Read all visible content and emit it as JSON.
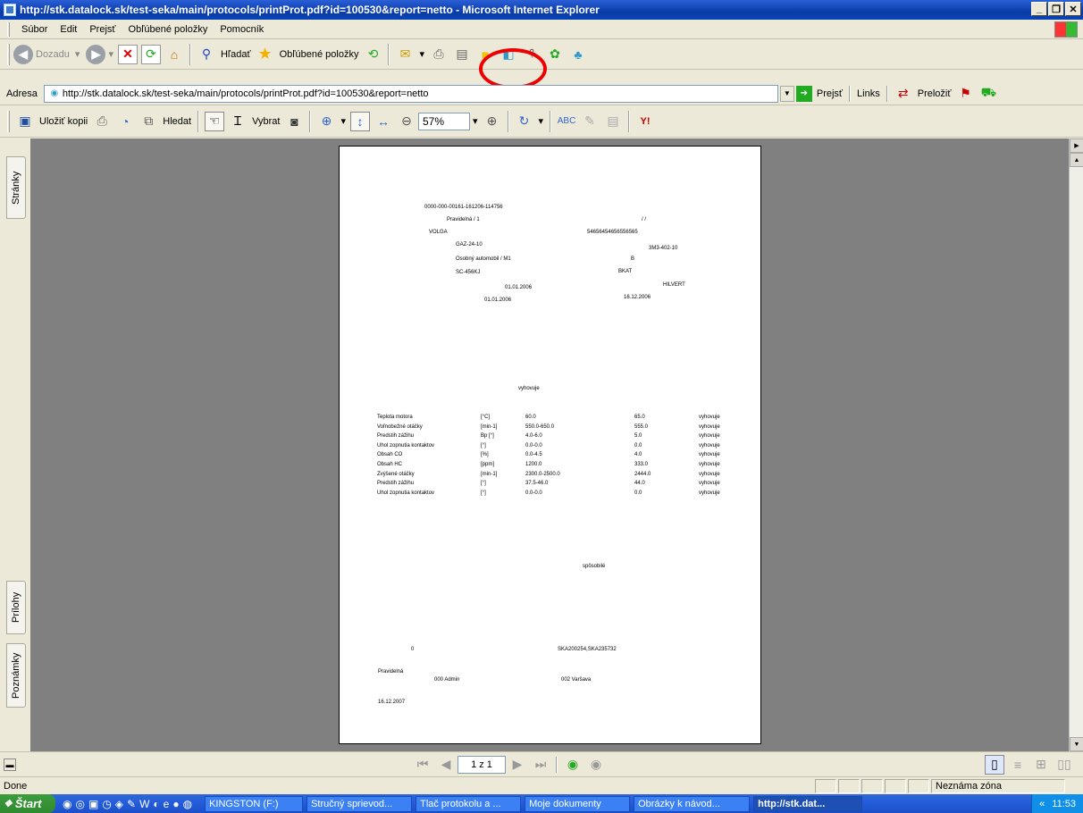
{
  "window": {
    "title": "http://stk.datalock.sk/test-seka/main/protocols/printProt.pdf?id=100530&report=netto - Microsoft Internet Explorer",
    "controls": [
      "_",
      "❐",
      "✕"
    ]
  },
  "menu": [
    "Súbor",
    "Edit",
    "Prejsť",
    "Obľúbené položky",
    "Pomocník"
  ],
  "toolbar1": {
    "back_label": "Dozadu",
    "search_label": "Hľadať",
    "favorites_label": "Obľúbené položky"
  },
  "address": {
    "label": "Adresa",
    "url": "http://stk.datalock.sk/test-seka/main/protocols/printProt.pdf?id=100530&report=netto",
    "go_label": "Prejsť",
    "links_label": "Links",
    "translate_label": "Preložiť"
  },
  "toolbar2": {
    "save_copy_label": "Uložiť kopii",
    "find_label": "Hledat",
    "select_label": "Vybrat",
    "zoom_value": "57%"
  },
  "side_tabs": {
    "pages": "Stránky",
    "attachments": "Prílohy",
    "notes": "Poznámky"
  },
  "document": {
    "header": {
      "protocol_no": "0000-000-00161-161206-114756",
      "type": "Pravidelná / 1",
      "slashes": "/ /",
      "make": "VOLGA",
      "vin": "54656454656556565",
      "model": "GAZ-24-10",
      "engine": "3M3-402-10",
      "category": "Osobný automobil / M1",
      "class": "B",
      "plate": "SC-456KJ",
      "owner": "BKAT",
      "date1": "01.01.2006",
      "holder": "HILVERT",
      "date2": "01.01.2006",
      "date3": "16.12.2006"
    },
    "result_top": "vyhovuje",
    "measurements": [
      {
        "name": "Teplota motora",
        "unit": "[°C]",
        "range": "60.0",
        "value": "65.0",
        "result": "vyhovuje"
      },
      {
        "name": "Voľnobežné otáčky",
        "unit": "[min-1]",
        "range": "550.0-650.0",
        "value": "555.0",
        "result": "vyhovuje"
      },
      {
        "name": "Predstih zážihu",
        "unit": "Bp [°]",
        "range": "4.0-6.0",
        "value": "5.0",
        "result": "vyhovuje"
      },
      {
        "name": "Uhol zopnutia kontaktov",
        "unit": "[°]",
        "range": "0.0-0.0",
        "value": "0.0",
        "result": "vyhovuje"
      },
      {
        "name": "Obsah CO",
        "unit": "[%]",
        "range": "0.0-4.5",
        "value": "4.0",
        "result": "vyhovuje"
      },
      {
        "name": "Obsah HC",
        "unit": "[ppm]",
        "range": "1200.0",
        "value": "333.0",
        "result": "vyhovuje"
      },
      {
        "name": "Zvýšené otáčky",
        "unit": "[min-1]",
        "range": "2300.0-2500.0",
        "value": "2444.0",
        "result": "vyhovuje"
      },
      {
        "name": "Predstih zážihu",
        "unit": "[°]",
        "range": "37.5-46.0",
        "value": "44.0",
        "result": "vyhovuje"
      },
      {
        "name": "Uhol zopnutia kontaktov",
        "unit": "[°]",
        "range": "0.0-0.0",
        "value": "0.0",
        "result": "vyhovuje"
      }
    ],
    "verdict": "spôsobilé",
    "footer": {
      "zero": "0",
      "codes": "SKA200254,SKA235732",
      "type": "Pravidelná",
      "admin": "000  Admin",
      "station": "002 Varšava",
      "date": "16.12.2007"
    }
  },
  "nav": {
    "page_indicator": "1 z 1"
  },
  "status": {
    "left": "Done",
    "zone": "Neznáma zóna"
  },
  "taskbar": {
    "start": "Štart",
    "tasks": [
      "KINGSTON (F:)",
      "Stručný sprievod...",
      "Tlač protokolu a ...",
      "Moje dokumenty",
      "Obrázky k návod...",
      "http://stk.dat..."
    ],
    "clock": "11:53",
    "chevron": "«"
  },
  "colors": {
    "title_bar": "#0a3ba8",
    "highlight_circle": "#e00000",
    "doc_background": "#808080"
  }
}
